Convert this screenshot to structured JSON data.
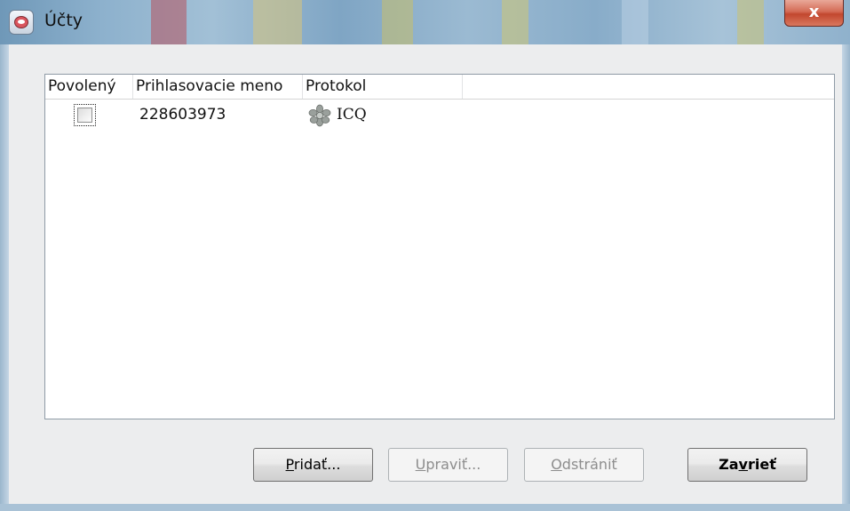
{
  "window": {
    "title": "Účty",
    "close_label": "x",
    "app_icon": "pidgin-app-icon"
  },
  "accounts_table": {
    "columns": [
      "Povolený",
      "Prihlasovacie meno",
      "Protokol"
    ],
    "rows": [
      {
        "enabled": false,
        "username": "228603973",
        "protocol": "ICQ",
        "protocol_icon": "icq-flower-icon"
      }
    ]
  },
  "buttons": {
    "add": {
      "mnemonic": "P",
      "rest": "ridať...",
      "enabled": true
    },
    "edit": {
      "mnemonic": "U",
      "rest": "praviť...",
      "enabled": false
    },
    "remove": {
      "mnemonic": "O",
      "rest": "dstrániť",
      "enabled": false
    },
    "close": {
      "pre": "Za",
      "mnemonic": "v",
      "rest": "rieť",
      "enabled": true
    }
  }
}
